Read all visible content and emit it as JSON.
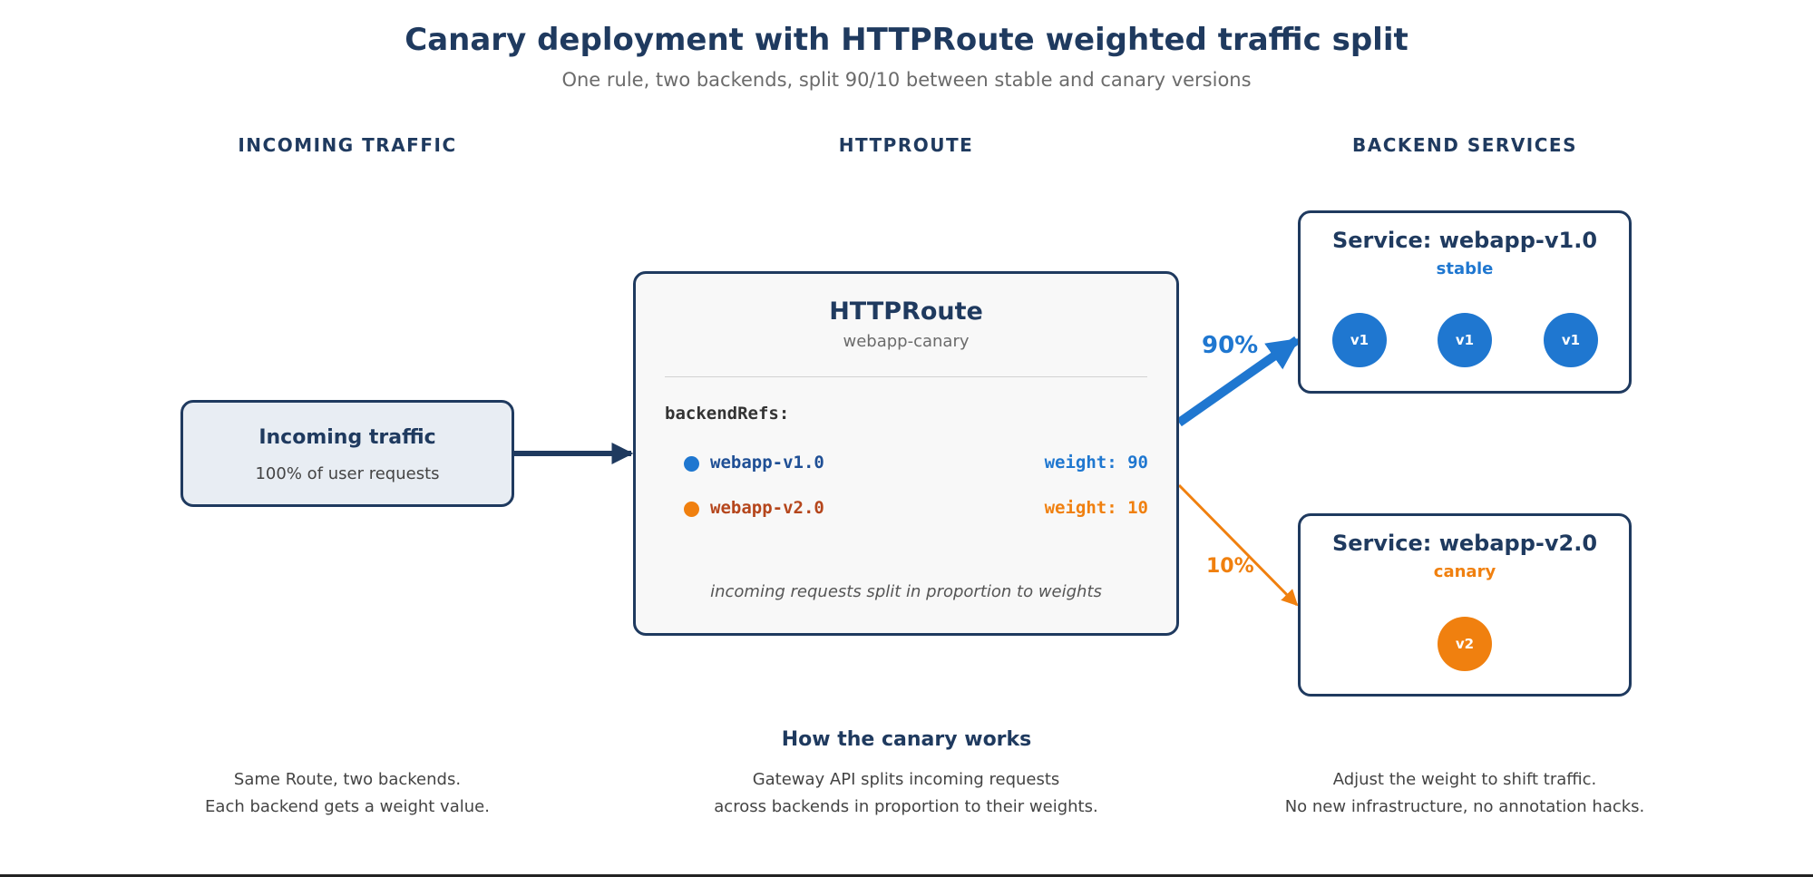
{
  "title": "Canary deployment with HTTPRoute weighted traffic split",
  "subtitle": "One rule, two backends, split 90/10 between stable and canary versions",
  "columns": {
    "left": "INCOMING TRAFFIC",
    "middle": "HTTPROUTE",
    "right": "BACKEND SERVICES"
  },
  "incoming": {
    "title": "Incoming traffic",
    "subtitle": "100% of user requests"
  },
  "route": {
    "title": "HTTPRoute",
    "name": "webapp-canary",
    "refs_label": "backendRefs:",
    "refs": [
      {
        "name": "webapp-v1.0",
        "weight_label": "weight: 90",
        "color": "#1f77d0"
      },
      {
        "name": "webapp-v2.0",
        "weight_label": "weight: 10",
        "color": "#f0800f"
      }
    ],
    "note": "incoming requests split in proportion to weights"
  },
  "arrows": {
    "stable_pct": "90%",
    "canary_pct": "10%"
  },
  "services": [
    {
      "title": "Service: webapp-v1.0",
      "tag": "stable",
      "color": "#1f77d0",
      "pods": [
        "v1",
        "v1",
        "v1"
      ]
    },
    {
      "title": "Service: webapp-v2.0",
      "tag": "canary",
      "color": "#f0800f",
      "pods": [
        "v2"
      ]
    }
  ],
  "how": {
    "title": "How the canary works",
    "notes": [
      {
        "line1": "Same Route, two backends.",
        "line2": "Each backend gets a weight value."
      },
      {
        "line1": "Gateway API splits incoming requests",
        "line2": "across backends in proportion to their weights."
      },
      {
        "line1": "Adjust the weight to shift traffic.",
        "line2": "No new infrastructure, no annotation hacks."
      }
    ]
  },
  "colors": {
    "navy": "#1f3a5f",
    "stable": "#1f77d0",
    "canary": "#f0800f"
  }
}
